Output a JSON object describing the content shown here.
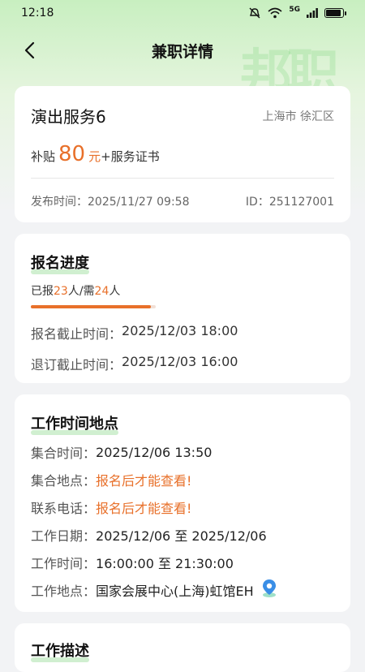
{
  "status": {
    "time": "12:18",
    "network": "5G"
  },
  "nav": {
    "title": "兼职详情",
    "watermark": "邦职"
  },
  "job": {
    "title": "演出服务6",
    "location": "上海市 徐汇区",
    "subsidy_label": "补贴",
    "subsidy_amount": "80",
    "subsidy_unit": "元",
    "subsidy_extra": "+服务证书",
    "publish_time": "发布时间：2025/11/27 09:58",
    "id": "ID：251127001"
  },
  "signup": {
    "section_title": "报名进度",
    "signed_prefix": "已报",
    "signed_count": "23",
    "signed_mid": "人/需",
    "required_count": "24",
    "required_suffix": "人",
    "progress": 0.958,
    "deadline_label": "报名截止时间：",
    "deadline_value": "2025/12/03 18:00",
    "cancel_label": "退订截止时间：",
    "cancel_value": "2025/12/03 16:00"
  },
  "work": {
    "section_title": "工作时间地点",
    "rows": [
      {
        "label": "集合时间：",
        "value": "2025/12/06 13:50"
      },
      {
        "label": "集合地点：",
        "value": "报名后才能查看!"
      },
      {
        "label": "联系电话：",
        "value": "报名后才能查看!"
      },
      {
        "label": "工作日期：",
        "value": "2025/12/06 至 2025/12/06"
      },
      {
        "label": "工作时间：",
        "value": "16:00:00 至 21:30:00"
      },
      {
        "label": "工作地点：",
        "value": "国家会展中心(上海)虹馆EH"
      }
    ]
  },
  "description": {
    "section_title": "工作描述"
  },
  "colors": {
    "accent": "#e8702a",
    "green": "#78d278"
  }
}
